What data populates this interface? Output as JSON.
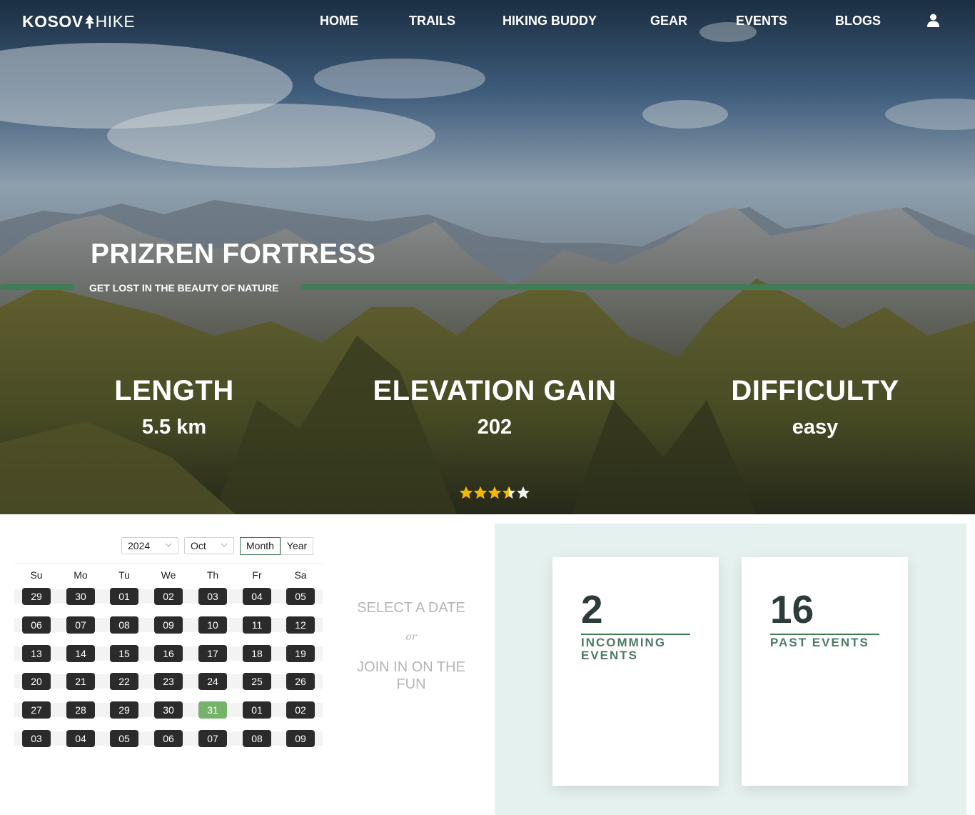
{
  "brand": {
    "part1": "KOSOV",
    "part2": "HIKE",
    "tree_icon": "pine-tree-icon"
  },
  "nav": {
    "items": [
      "HOME",
      "TRAILS",
      "HIKING BUDDY",
      "GEAR",
      "EVENTS",
      "BLOGS"
    ],
    "user_icon": "user-icon"
  },
  "trail": {
    "title": "PRIZREN FORTRESS",
    "tagline": "GET LOST IN THE BEAUTY OF NATURE",
    "stats": [
      {
        "label": "LENGTH",
        "value": "5.5 km"
      },
      {
        "label": "ELEVATION GAIN",
        "value": "202"
      },
      {
        "label": "DIFFICULTY",
        "value": "easy"
      }
    ],
    "rating": {
      "value": 3.5,
      "max": 5
    }
  },
  "calendar": {
    "year": "2024",
    "month": "Oct",
    "mode_month": "Month",
    "mode_year": "Year",
    "weekdays": [
      "Su",
      "Mo",
      "Tu",
      "We",
      "Th",
      "Fr",
      "Sa"
    ],
    "weeks": [
      [
        "29",
        "30",
        "01",
        "02",
        "03",
        "04",
        "05"
      ],
      [
        "06",
        "07",
        "08",
        "09",
        "10",
        "11",
        "12"
      ],
      [
        "13",
        "14",
        "15",
        "16",
        "17",
        "18",
        "19"
      ],
      [
        "20",
        "21",
        "22",
        "23",
        "24",
        "25",
        "26"
      ],
      [
        "27",
        "28",
        "29",
        "30",
        "31",
        "01",
        "02"
      ],
      [
        "03",
        "04",
        "05",
        "06",
        "07",
        "08",
        "09"
      ]
    ],
    "selected_day": "31"
  },
  "cta": {
    "select": "SELECT A DATE",
    "or": "or",
    "join": "JOIN IN ON THE FUN"
  },
  "events": {
    "incoming": {
      "count": "2",
      "label": "INCOMMING EVENTS"
    },
    "past": {
      "count": "16",
      "label": "PAST EVENTS"
    }
  },
  "colors": {
    "accent_green": "#3f7d55",
    "today_green": "#76b26b",
    "panel_bg": "#e5f1ee",
    "star": "#f5b800"
  }
}
